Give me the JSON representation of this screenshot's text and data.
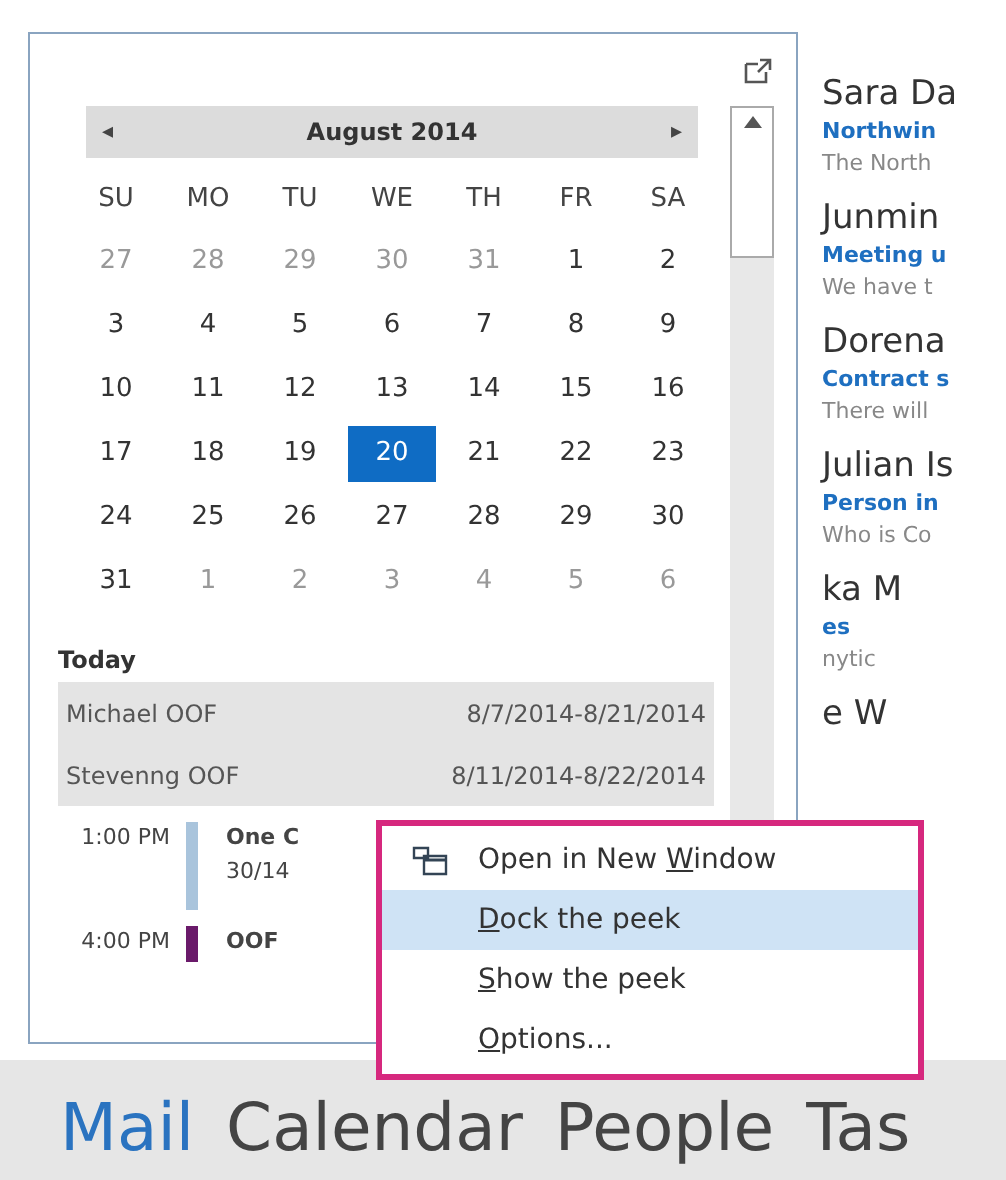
{
  "calendar": {
    "month": "August 2014",
    "prev": "◂",
    "next": "▸",
    "weekdays": [
      "SU",
      "MO",
      "TU",
      "WE",
      "TH",
      "FR",
      "SA"
    ],
    "weeks": [
      [
        {
          "day": "27",
          "other": true,
          "selected": false
        },
        {
          "day": "28",
          "other": true,
          "selected": false
        },
        {
          "day": "29",
          "other": true,
          "selected": false
        },
        {
          "day": "30",
          "other": true,
          "selected": false
        },
        {
          "day": "31",
          "other": true,
          "selected": false
        },
        {
          "day": "1",
          "other": false,
          "selected": false
        },
        {
          "day": "2",
          "other": false,
          "selected": false
        }
      ],
      [
        {
          "day": "3",
          "other": false,
          "selected": false
        },
        {
          "day": "4",
          "other": false,
          "selected": false
        },
        {
          "day": "5",
          "other": false,
          "selected": false
        },
        {
          "day": "6",
          "other": false,
          "selected": false
        },
        {
          "day": "7",
          "other": false,
          "selected": false
        },
        {
          "day": "8",
          "other": false,
          "selected": false
        },
        {
          "day": "9",
          "other": false,
          "selected": false
        }
      ],
      [
        {
          "day": "10",
          "other": false,
          "selected": false
        },
        {
          "day": "11",
          "other": false,
          "selected": false
        },
        {
          "day": "12",
          "other": false,
          "selected": false
        },
        {
          "day": "13",
          "other": false,
          "selected": false
        },
        {
          "day": "14",
          "other": false,
          "selected": false
        },
        {
          "day": "15",
          "other": false,
          "selected": false
        },
        {
          "day": "16",
          "other": false,
          "selected": false
        }
      ],
      [
        {
          "day": "17",
          "other": false,
          "selected": false
        },
        {
          "day": "18",
          "other": false,
          "selected": false
        },
        {
          "day": "19",
          "other": false,
          "selected": false
        },
        {
          "day": "20",
          "other": false,
          "selected": true
        },
        {
          "day": "21",
          "other": false,
          "selected": false
        },
        {
          "day": "22",
          "other": false,
          "selected": false
        },
        {
          "day": "23",
          "other": false,
          "selected": false
        }
      ],
      [
        {
          "day": "24",
          "other": false,
          "selected": false
        },
        {
          "day": "25",
          "other": false,
          "selected": false
        },
        {
          "day": "26",
          "other": false,
          "selected": false
        },
        {
          "day": "27",
          "other": false,
          "selected": false
        },
        {
          "day": "28",
          "other": false,
          "selected": false
        },
        {
          "day": "29",
          "other": false,
          "selected": false
        },
        {
          "day": "30",
          "other": false,
          "selected": false
        }
      ],
      [
        {
          "day": "31",
          "other": false,
          "selected": false
        },
        {
          "day": "1",
          "other": true,
          "selected": false
        },
        {
          "day": "2",
          "other": true,
          "selected": false
        },
        {
          "day": "3",
          "other": true,
          "selected": false
        },
        {
          "day": "4",
          "other": true,
          "selected": false
        },
        {
          "day": "5",
          "other": true,
          "selected": false
        },
        {
          "day": "6",
          "other": true,
          "selected": false
        }
      ]
    ]
  },
  "agenda": {
    "heading": "Today",
    "all_day": [
      {
        "title": "Michael OOF",
        "dates": "8/7/2014-8/21/2014"
      },
      {
        "title": "Stevenng OOF",
        "dates": "8/11/2014-8/22/2014"
      }
    ],
    "events": [
      {
        "time": "1:00 PM",
        "title": "One C",
        "detail": "30/14",
        "color": "#a9c4dc"
      },
      {
        "time": "4:00 PM",
        "title": "OOF",
        "color": "#6a1a6a"
      }
    ]
  },
  "messages": [
    {
      "sender": "Sara Da",
      "subject": "Northwin",
      "preview": "The North"
    },
    {
      "sender": "Junmin",
      "subject": "Meeting u",
      "preview": "We have t"
    },
    {
      "sender": "Dorena",
      "subject": "Contract s",
      "preview": "There will"
    },
    {
      "sender": "Julian Is",
      "subject": "Person in",
      "preview": "Who is Co"
    },
    {
      "sender": "ka M",
      "subject": "es",
      "preview": "nytic"
    },
    {
      "sender": "e W"
    }
  ],
  "nav": [
    {
      "label": "Mail",
      "selected": true
    },
    {
      "label": "Calendar",
      "selected": false
    },
    {
      "label": "People",
      "selected": false
    },
    {
      "label": "Tas",
      "selected": false
    }
  ],
  "context_menu": [
    {
      "before": "Open in New ",
      "key": "W",
      "after": "indow",
      "selected": false,
      "kind": "icon"
    },
    {
      "key": "D",
      "after": "ock the peek",
      "selected": true,
      "kind": "plain"
    },
    {
      "key": "S",
      "after": "how the peek",
      "selected": false,
      "kind": "plain"
    },
    {
      "key": "O",
      "after": "ptions...",
      "selected": false,
      "kind": "plain"
    }
  ]
}
